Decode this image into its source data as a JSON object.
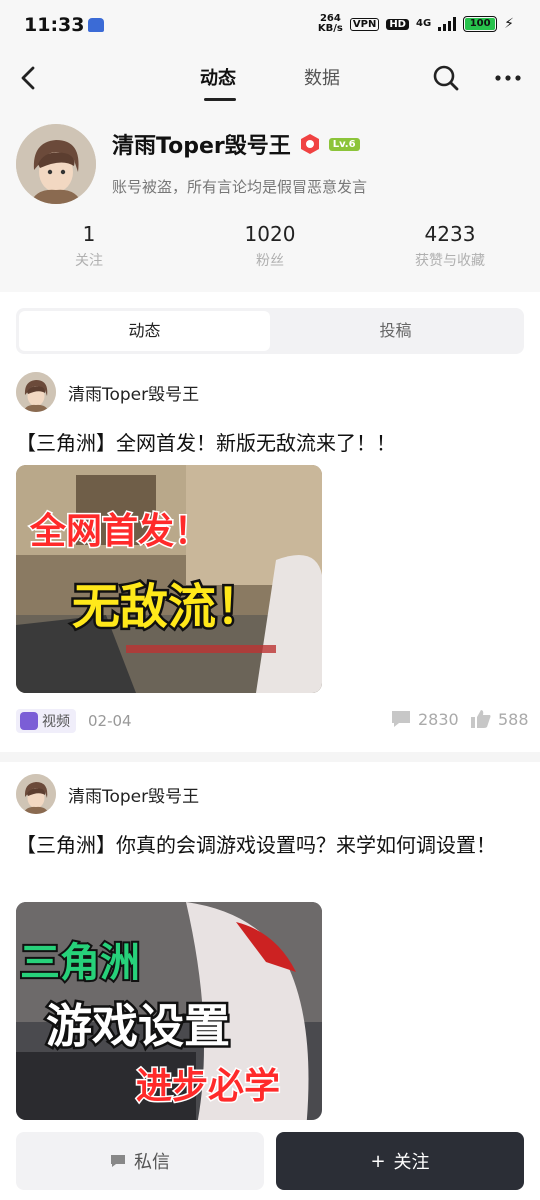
{
  "status_bar": {
    "time": "11:33",
    "speed_value": "264",
    "speed_unit": "KB/s",
    "vpn_label": "VPN",
    "hd_label": "HD",
    "network": "4G",
    "battery": "100"
  },
  "header": {
    "tabs": [
      {
        "label": "动态",
        "active": true
      },
      {
        "label": "数据",
        "active": false
      }
    ]
  },
  "profile": {
    "name": "清雨Toper毁号王",
    "level": "Lv.6",
    "bio": "账号被盗，所有言论均是假冒恶意发言",
    "stats": [
      {
        "value": "1",
        "label": "关注"
      },
      {
        "value": "1020",
        "label": "粉丝"
      },
      {
        "value": "4233",
        "label": "获赞与收藏"
      }
    ]
  },
  "content_tabs": [
    {
      "label": "动态",
      "active": true
    },
    {
      "label": "投稿",
      "active": false
    }
  ],
  "posts": [
    {
      "author": "清雨Toper毁号王",
      "title": "【三角洲】全网首发！新版无敌流来了！！",
      "thumb_line1": "全网首发！",
      "thumb_line2": "无敌流！",
      "type_label": "视频",
      "date": "02-04",
      "comments": "2830",
      "likes": "588"
    },
    {
      "author": "清雨Toper毁号王",
      "title": "【三角洲】你真的会调游戏设置吗？来学如何调设置！",
      "thumb_line1": "三角洲",
      "thumb_line2": "游戏设置",
      "thumb_line3": "进步必学"
    }
  ],
  "bottom_bar": {
    "message_label": "私信",
    "follow_label": "关注",
    "follow_prefix": "+"
  },
  "colors": {
    "accent_dark": "#2b2e36",
    "level_badge": "#8cc43a",
    "video_tag": "#7b5ed6",
    "thumb_red_text": "#ff2a2a",
    "thumb_yellow_text": "#ffe81a",
    "thumb_green_text": "#27d17a"
  }
}
